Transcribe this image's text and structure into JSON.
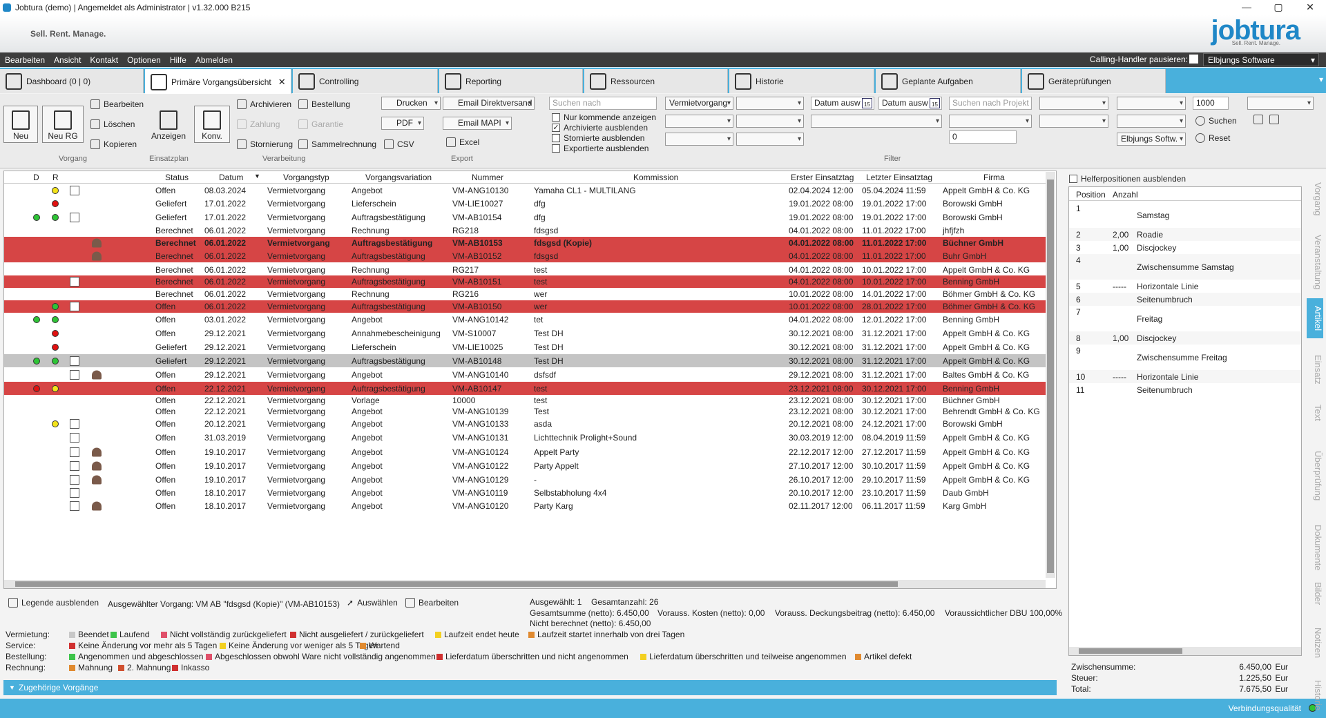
{
  "window": {
    "title": "Jobtura (demo) | Angemeldet als Administrator | v1.32.000 B215",
    "min": "—",
    "max": "▢",
    "close": "✕"
  },
  "brand": {
    "tagline": "Sell. Rent. Manage.",
    "logo": "jobtura",
    "logo_sub": "Sell. Rent. Manage."
  },
  "menu": [
    "Bearbeiten",
    "Ansicht",
    "Kontakt",
    "Optionen",
    "Hilfe",
    "Abmelden"
  ],
  "calling": "Calling-Handler pausieren:",
  "company_select": "Elbjungs Software",
  "tabs": [
    {
      "label": "Dashboard (0 | 0)"
    },
    {
      "label": "Primäre Vorgangsübersicht",
      "close": "✕"
    },
    {
      "label": "Controlling"
    },
    {
      "label": "Reporting"
    },
    {
      "label": "Ressourcen"
    },
    {
      "label": "Historie"
    },
    {
      "label": "Geplante Aufgaben"
    },
    {
      "label": "Geräteprüfungen"
    }
  ],
  "ribbon": {
    "neu": "Neu",
    "neu_rg": "Neu RG",
    "bearbeiten": "Bearbeiten",
    "loeschen": "Löschen",
    "kopieren": "Kopieren",
    "grp_vorgang": "Vorgang",
    "anzeigen": "Anzeigen",
    "grp_einsatz": "Einsatzplan",
    "konv": "Konv.",
    "archivieren": "Archivieren",
    "zahlung": "Zahlung",
    "stornierung": "Stornierung",
    "bestellung": "Bestellung",
    "garantie": "Garantie",
    "sammelrechnung": "Sammelrechnung",
    "grp_verarbeitung": "Verarbeitung",
    "drucken": "Drucken",
    "pdf": "PDF",
    "csv": "CSV",
    "email_direkt": "Email Direktversand",
    "email_mapi": "Email MAPI",
    "excel": "Excel",
    "grp_export": "Export",
    "suchen_nach": "Suchen nach",
    "cb1": "Nur kommende anzeigen",
    "cb2": "Archivierte ausblenden",
    "cb3": "Stornierte ausblenden",
    "cb4": "Exportierte ausblenden",
    "vermiet": "Vermietvorgang",
    "datum1": "Datum ausw",
    "datum2": "Datum ausw",
    "projekt": "Suchen nach Projekt",
    "num0": "0",
    "firm2": "Elbjungs Softw.",
    "limit": "1000",
    "suchen": "Suchen",
    "reset": "Reset",
    "grp_filter": "Filter"
  },
  "grid": {
    "headers": [
      "D",
      "R",
      "Status",
      "Datum",
      "Vorgangstyp",
      "Vorgangsvariation",
      "Nummer",
      "Kommission",
      "Erster Einsatztag",
      "Letzter Einsatztag",
      "Firma"
    ],
    "rows": [
      {
        "d": "",
        "r": "dy",
        "ic": "box",
        "pe": "",
        "st": "Offen",
        "da": "08.03.2024",
        "ty": "Vermietvorgang",
        "va": "Angebot",
        "nu": "VM-ANG10130",
        "ko": "Yamaha CL1 - MULTILANG",
        "e1": "02.04.2024 12:00",
        "e2": "05.04.2024 11:59",
        "fi": "Appelt GmbH & Co. KG",
        "style": ""
      },
      {
        "d": "",
        "r": "dr",
        "ic": "",
        "pe": "",
        "st": "Geliefert",
        "da": "17.01.2022",
        "ty": "Vermietvorgang",
        "va": "Lieferschein",
        "nu": "VM-LIE10027",
        "ko": "dfg",
        "e1": "19.01.2022 08:00",
        "e2": "19.01.2022 17:00",
        "fi": "Borowski GmbH",
        "style": ""
      },
      {
        "d": "dg",
        "r": "dg",
        "ic": "box",
        "pe": "",
        "st": "Geliefert",
        "da": "17.01.2022",
        "ty": "Vermietvorgang",
        "va": "Auftragsbestätigung",
        "nu": "VM-AB10154",
        "ko": "dfg",
        "e1": "19.01.2022 08:00",
        "e2": "19.01.2022 17:00",
        "fi": "Borowski GmbH",
        "style": ""
      },
      {
        "d": "",
        "r": "",
        "ic": "",
        "pe": "",
        "st": "Berechnet",
        "da": "06.01.2022",
        "ty": "Vermietvorgang",
        "va": "Rechnung",
        "nu": "RG218",
        "ko": "fdsgsd",
        "e1": "04.01.2022 08:00",
        "e2": "11.01.2022 17:00",
        "fi": "jhfjfzh",
        "style": ""
      },
      {
        "d": "",
        "r": "",
        "ic": "",
        "pe": "per",
        "st": "Berechnet",
        "da": "06.01.2022",
        "ty": "Vermietvorgang",
        "va": "Auftragsbestätigung",
        "nu": "VM-AB10153",
        "ko": "fdsgsd (Kopie)",
        "e1": "04.01.2022 08:00",
        "e2": "11.01.2022 17:00",
        "fi": "Büchner GmbH",
        "style": "red bold"
      },
      {
        "d": "",
        "r": "",
        "ic": "",
        "pe": "per",
        "st": "Berechnet",
        "da": "06.01.2022",
        "ty": "Vermietvorgang",
        "va": "Auftragsbestätigung",
        "nu": "VM-AB10152",
        "ko": "fdsgsd",
        "e1": "04.01.2022 08:00",
        "e2": "11.01.2022 17:00",
        "fi": "Buhr GmbH",
        "style": "red"
      },
      {
        "d": "",
        "r": "",
        "ic": "",
        "pe": "",
        "st": "Berechnet",
        "da": "06.01.2022",
        "ty": "Vermietvorgang",
        "va": "Rechnung",
        "nu": "RG217",
        "ko": "test",
        "e1": "04.01.2022 08:00",
        "e2": "10.01.2022 17:00",
        "fi": "Appelt GmbH & Co. KG",
        "style": ""
      },
      {
        "d": "",
        "r": "",
        "ic": "box",
        "pe": "",
        "st": "Berechnet",
        "da": "06.01.2022",
        "ty": "Vermietvorgang",
        "va": "Auftragsbestätigung",
        "nu": "VM-AB10151",
        "ko": "test",
        "e1": "04.01.2022 08:00",
        "e2": "10.01.2022 17:00",
        "fi": "Benning GmbH",
        "style": "red"
      },
      {
        "d": "",
        "r": "",
        "ic": "",
        "pe": "",
        "st": "Berechnet",
        "da": "06.01.2022",
        "ty": "Vermietvorgang",
        "va": "Rechnung",
        "nu": "RG216",
        "ko": "wer",
        "e1": "10.01.2022 08:00",
        "e2": "14.01.2022 17:00",
        "fi": "Böhmer GmbH & Co. KG",
        "style": ""
      },
      {
        "d": "",
        "r": "dg",
        "ic": "box",
        "pe": "",
        "st": "Offen",
        "da": "06.01.2022",
        "ty": "Vermietvorgang",
        "va": "Auftragsbestätigung",
        "nu": "VM-AB10150",
        "ko": "wer",
        "e1": "10.01.2022 08:00",
        "e2": "28.01.2022 17:00",
        "fi": "Böhmer GmbH & Co. KG",
        "style": "red"
      },
      {
        "d": "dg",
        "r": "dg",
        "ic": "",
        "pe": "",
        "st": "Offen",
        "da": "03.01.2022",
        "ty": "Vermietvorgang",
        "va": "Angebot",
        "nu": "VM-ANG10142",
        "ko": "tet",
        "e1": "04.01.2022 08:00",
        "e2": "12.01.2022 17:00",
        "fi": "Benning GmbH",
        "style": ""
      },
      {
        "d": "",
        "r": "dr",
        "ic": "",
        "pe": "",
        "st": "Offen",
        "da": "29.12.2021",
        "ty": "Vermietvorgang",
        "va": "Annahmebescheinigung",
        "nu": "VM-S10007",
        "ko": "Test DH",
        "e1": "30.12.2021 08:00",
        "e2": "31.12.2021 17:00",
        "fi": "Appelt GmbH & Co. KG",
        "style": ""
      },
      {
        "d": "",
        "r": "dr",
        "ic": "",
        "pe": "",
        "st": "Geliefert",
        "da": "29.12.2021",
        "ty": "Vermietvorgang",
        "va": "Lieferschein",
        "nu": "VM-LIE10025",
        "ko": "Test DH",
        "e1": "30.12.2021 08:00",
        "e2": "31.12.2021 17:00",
        "fi": "Appelt GmbH & Co. KG",
        "style": ""
      },
      {
        "d": "dg",
        "r": "dg",
        "ic": "box",
        "pe": "",
        "st": "Geliefert",
        "da": "29.12.2021",
        "ty": "Vermietvorgang",
        "va": "Auftragsbestätigung",
        "nu": "VM-AB10148",
        "ko": "Test DH",
        "e1": "30.12.2021 08:00",
        "e2": "31.12.2021 17:00",
        "fi": "Appelt GmbH & Co. KG",
        "style": "gray"
      },
      {
        "d": "",
        "r": "",
        "ic": "box",
        "pe": "per",
        "st": "Offen",
        "da": "29.12.2021",
        "ty": "Vermietvorgang",
        "va": "Angebot",
        "nu": "VM-ANG10140",
        "ko": "dsfsdf",
        "e1": "29.12.2021 08:00",
        "e2": "31.12.2021 17:00",
        "fi": "Baltes GmbH & Co. KG",
        "style": ""
      },
      {
        "d": "dr",
        "r": "dy",
        "ic": "",
        "pe": "",
        "st": "Offen",
        "da": "22.12.2021",
        "ty": "Vermietvorgang",
        "va": "Auftragsbestätigung",
        "nu": "VM-AB10147",
        "ko": "test",
        "e1": "23.12.2021 08:00",
        "e2": "30.12.2021 17:00",
        "fi": "Benning GmbH",
        "style": "red"
      },
      {
        "d": "",
        "r": "",
        "ic": "",
        "pe": "",
        "st": "Offen",
        "da": "22.12.2021",
        "ty": "Vermietvorgang",
        "va": "Vorlage",
        "nu": "10000",
        "ko": "test",
        "e1": "23.12.2021 08:00",
        "e2": "30.12.2021 17:00",
        "fi": "Büchner GmbH",
        "style": ""
      },
      {
        "d": "",
        "r": "",
        "ic": "",
        "pe": "",
        "st": "Offen",
        "da": "22.12.2021",
        "ty": "Vermietvorgang",
        "va": "Angebot",
        "nu": "VM-ANG10139",
        "ko": "Test",
        "e1": "23.12.2021 08:00",
        "e2": "30.12.2021 17:00",
        "fi": "Behrendt GmbH & Co. KG",
        "style": ""
      },
      {
        "d": "",
        "r": "dy",
        "ic": "box",
        "pe": "",
        "st": "Offen",
        "da": "20.12.2021",
        "ty": "Vermietvorgang",
        "va": "Angebot",
        "nu": "VM-ANG10133",
        "ko": "asda",
        "e1": "20.12.2021 08:00",
        "e2": "24.12.2021 17:00",
        "fi": "Borowski GmbH",
        "style": ""
      },
      {
        "d": "",
        "r": "",
        "ic": "box",
        "pe": "",
        "st": "Offen",
        "da": "31.03.2019",
        "ty": "Vermietvorgang",
        "va": "Angebot",
        "nu": "VM-ANG10131",
        "ko": "Lichttechnik Prolight+Sound",
        "e1": "30.03.2019 12:00",
        "e2": "08.04.2019 11:59",
        "fi": "Appelt GmbH & Co. KG",
        "style": ""
      },
      {
        "d": "",
        "r": "",
        "ic": "box",
        "pe": "per",
        "st": "Offen",
        "da": "19.10.2017",
        "ty": "Vermietvorgang",
        "va": "Angebot",
        "nu": "VM-ANG10124",
        "ko": "Appelt Party",
        "e1": "22.12.2017 12:00",
        "e2": "27.12.2017 11:59",
        "fi": "Appelt GmbH & Co. KG",
        "style": ""
      },
      {
        "d": "",
        "r": "",
        "ic": "box",
        "pe": "per",
        "st": "Offen",
        "da": "19.10.2017",
        "ty": "Vermietvorgang",
        "va": "Angebot",
        "nu": "VM-ANG10122",
        "ko": "Party Appelt",
        "e1": "27.10.2017 12:00",
        "e2": "30.10.2017 11:59",
        "fi": "Appelt GmbH & Co. KG",
        "style": ""
      },
      {
        "d": "",
        "r": "",
        "ic": "box",
        "pe": "per",
        "st": "Offen",
        "da": "19.10.2017",
        "ty": "Vermietvorgang",
        "va": "Angebot",
        "nu": "VM-ANG10129",
        "ko": "-",
        "e1": "26.10.2017 12:00",
        "e2": "29.10.2017 11:59",
        "fi": "Appelt GmbH & Co. KG",
        "style": ""
      },
      {
        "d": "",
        "r": "",
        "ic": "box",
        "pe": "",
        "st": "Offen",
        "da": "18.10.2017",
        "ty": "Vermietvorgang",
        "va": "Angebot",
        "nu": "VM-ANG10119",
        "ko": "Selbstabholung 4x4",
        "e1": "20.10.2017 12:00",
        "e2": "23.10.2017 11:59",
        "fi": "Daub GmbH",
        "style": ""
      },
      {
        "d": "",
        "r": "",
        "ic": "box",
        "pe": "per",
        "st": "Offen",
        "da": "18.10.2017",
        "ty": "Vermietvorgang",
        "va": "Angebot",
        "nu": "VM-ANG10120",
        "ko": "Party Karg",
        "e1": "02.11.2017 12:00",
        "e2": "06.11.2017 11:59",
        "fi": "Karg GmbH",
        "style": ""
      }
    ]
  },
  "status": {
    "legend_toggle": "Legende ausblenden",
    "selected": "Ausgewählter Vorgang: VM AB \"fdsgsd (Kopie)\" (VM-AB10153)",
    "auswaehlen": "Auswählen",
    "bearbeiten": "Bearbeiten",
    "sel_count": "Ausgewählt: 1",
    "total_count": "Gesamtanzahl: 26",
    "sum": "Gesamtsumme (netto): 6.450,00",
    "costs": "Vorauss. Kosten (netto): 0,00",
    "margin": "Vorauss. Deckungsbeitrag (netto): 6.450,00",
    "dbu": "Voraussichtlicher DBU 100,00%",
    "unbilled": "Nicht berechnet (netto): 6.450,00"
  },
  "legend": [
    {
      "cat": "Vermietung:",
      "items": [
        {
          "c": "#c8c8c8",
          "t": "Beendet"
        },
        {
          "c": "#3dc44a",
          "t": "Laufend"
        },
        {
          "c": "#e0506a",
          "t": "Nicht vollständig zurückgeliefert"
        },
        {
          "c": "#d03030",
          "t": "Nicht ausgeliefert / zurückgeliefert"
        },
        {
          "c": "#f3d020",
          "t": "Laufzeit endet heute"
        },
        {
          "c": "#e08a30",
          "t": "Laufzeit startet innerhalb von drei Tagen"
        }
      ]
    },
    {
      "cat": "Service:",
      "items": [
        {
          "c": "#d03030",
          "t": "Keine Änderung vor mehr als 5 Tagen"
        },
        {
          "c": "#f3d020",
          "t": "Keine Änderung vor weniger als 5 Tagen"
        },
        {
          "c": "#e08a30",
          "t": "Wartend"
        }
      ]
    },
    {
      "cat": "Bestellung:",
      "items": [
        {
          "c": "#3dc44a",
          "t": "Angenommen und abgeschlossen"
        },
        {
          "c": "#e0506a",
          "t": "Abgeschlossen obwohl Ware nicht vollständig angenommen"
        },
        {
          "c": "#d03030",
          "t": "Lieferdatum überschritten und nicht angenommen"
        },
        {
          "c": "#f3d020",
          "t": "Lieferdatum überschritten und teilweise angenommen"
        },
        {
          "c": "#e08a30",
          "t": "Artikel defekt"
        }
      ]
    },
    {
      "cat": "Rechnung:",
      "items": [
        {
          "c": "#e08a30",
          "t": "Mahnung"
        },
        {
          "c": "#d05030",
          "t": "2. Mahnung"
        },
        {
          "c": "#d03030",
          "t": "Inkasso"
        }
      ]
    }
  ],
  "zugehoerig": "Zugehörige Vorgänge",
  "footer": {
    "quality": "Verbindungsqualität"
  },
  "right": {
    "helper": "Helferpositionen ausblenden",
    "h_pos": "Position",
    "h_anz": "Anzahl",
    "rows": [
      {
        "p": "1",
        "a": "",
        "t": "Samstag",
        "tall": true
      },
      {
        "p": "2",
        "a": "2,00",
        "t": "Roadie",
        "tall": false
      },
      {
        "p": "3",
        "a": "1,00",
        "t": "Discjockey",
        "tall": false
      },
      {
        "p": "4",
        "a": "",
        "t": "Zwischensumme Samstag",
        "tall": true
      },
      {
        "p": "5",
        "a": "-----",
        "t": "Horizontale Linie",
        "tall": false
      },
      {
        "p": "6",
        "a": "",
        "t": "Seitenumbruch",
        "tall": false
      },
      {
        "p": "7",
        "a": "",
        "t": "Freitag",
        "tall": true
      },
      {
        "p": "8",
        "a": "1,00",
        "t": "Discjockey",
        "tall": false
      },
      {
        "p": "9",
        "a": "",
        "t": "Zwischensumme Freitag",
        "tall": true
      },
      {
        "p": "10",
        "a": "-----",
        "t": "Horizontale Linie",
        "tall": false
      },
      {
        "p": "11",
        "a": "",
        "t": "Seitenumbruch",
        "tall": false
      }
    ],
    "zw_label": "Zwischensumme:",
    "zw_val": "6.450,00",
    "zw_cur": "Eur",
    "st_label": "Steuer:",
    "st_val": "1.225,50",
    "st_cur": "Eur",
    "tot_label": "Total:",
    "tot_val": "7.675,50",
    "tot_cur": "Eur"
  },
  "vtabs": [
    "Vorgang",
    "Veranstaltung",
    "Artikel",
    "Einsatz",
    "Text",
    "Überprüfung",
    "Dokumente",
    "Bilder",
    "Notizen",
    "Historie"
  ],
  "colors": {
    "accent": "#49b0dc",
    "red_row": "#d64545",
    "selected_row": "#c4c4c4"
  }
}
